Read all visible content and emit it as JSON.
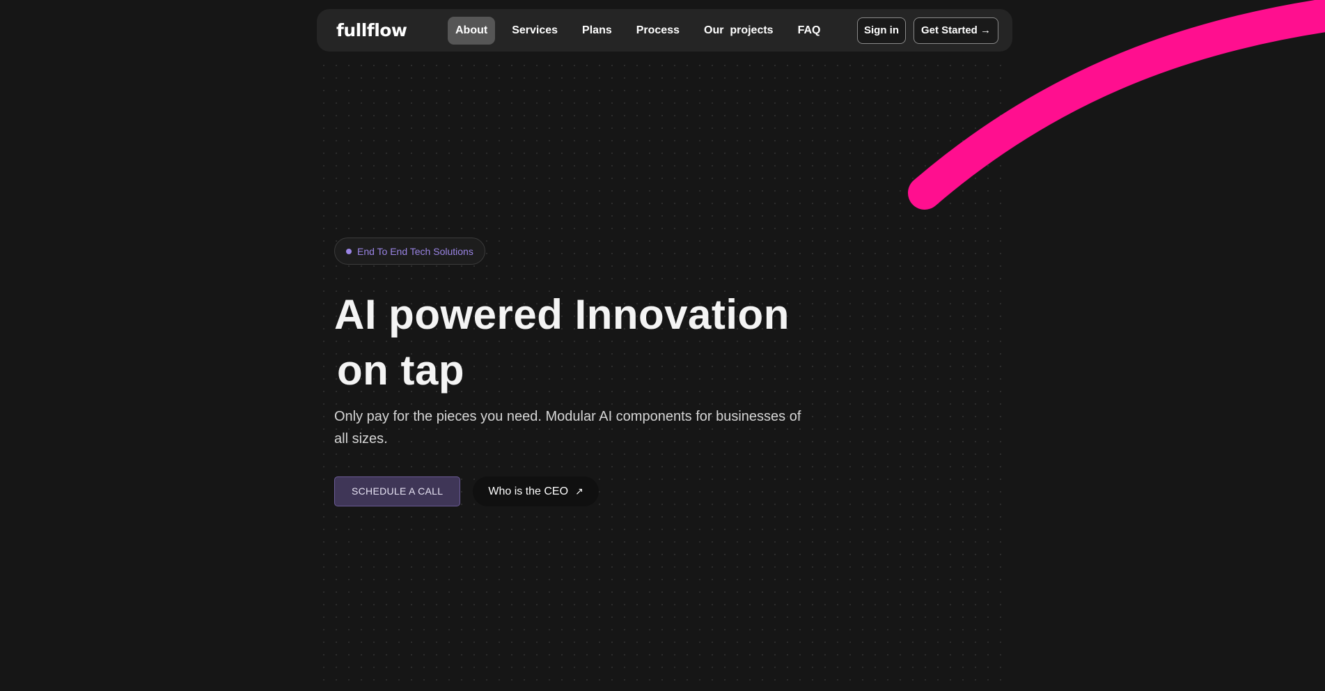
{
  "nav": {
    "logo": "fullflow",
    "links": [
      {
        "label": "About",
        "active": true
      },
      {
        "label": "Services"
      },
      {
        "label": "Plans"
      },
      {
        "label": "Process"
      },
      {
        "label": "Our  projects"
      },
      {
        "label": "FAQ"
      }
    ],
    "sign_in": "Sign in",
    "get_started": "Get Started →"
  },
  "hero": {
    "badge": "End To End Tech Solutions",
    "headline_line1": "AI powered Innovation",
    "headline_line2": "on tap",
    "subtext": "Only pay for the pieces you need. Modular AI components for businesses of all sizes.",
    "schedule_label": "SCHEDULE A CALL",
    "ceo_label": "Who is the CEO",
    "ceo_icon": "arrow-up-right-icon"
  },
  "colors": {
    "background": "#161616",
    "accent_pink": "#ff1493",
    "badge_purple": "#9b85e6",
    "button_purple": "#3f3657"
  }
}
